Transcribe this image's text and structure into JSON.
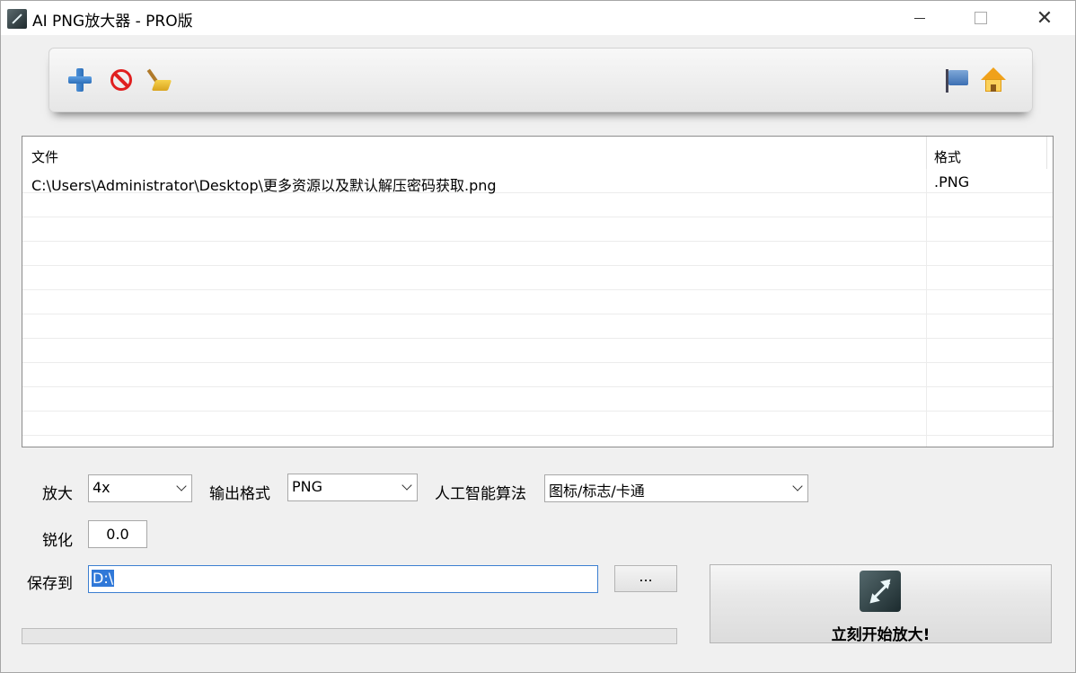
{
  "window": {
    "title": "AI PNG放大器 - PRO版",
    "controls": {
      "minimize": "minimize-icon",
      "maximize": "maximize-icon",
      "close": "close-icon"
    }
  },
  "toolbar": {
    "left_icons": [
      "add-icon",
      "remove-icon",
      "clear-broom-icon"
    ],
    "right_icons": [
      "flag-icon",
      "home-icon"
    ]
  },
  "filelist": {
    "columns": [
      "文件",
      "格式"
    ],
    "rows": [
      {
        "file": "C:\\Users\\Administrator\\Desktop\\更多资源以及默认解压密码获取.png",
        "format": ".PNG"
      }
    ]
  },
  "options": {
    "scale_label": "放大",
    "scale_value": "4x",
    "format_label": "输出格式",
    "format_value": "PNG",
    "ai_label": "人工智能算法",
    "ai_value": "图标/标志/卡通",
    "sharpen_label": "锐化",
    "sharpen_value": "0.0",
    "saveto_label": "保存到",
    "saveto_value": "D:\\",
    "browse_label": "..."
  },
  "progress": {
    "value": 0
  },
  "start_button": {
    "label": "立刻开始放大!",
    "icon": "enlarge-arrows-icon"
  },
  "colors": {
    "accent": "#3078d8",
    "window_bg": "#f0f0f0"
  }
}
